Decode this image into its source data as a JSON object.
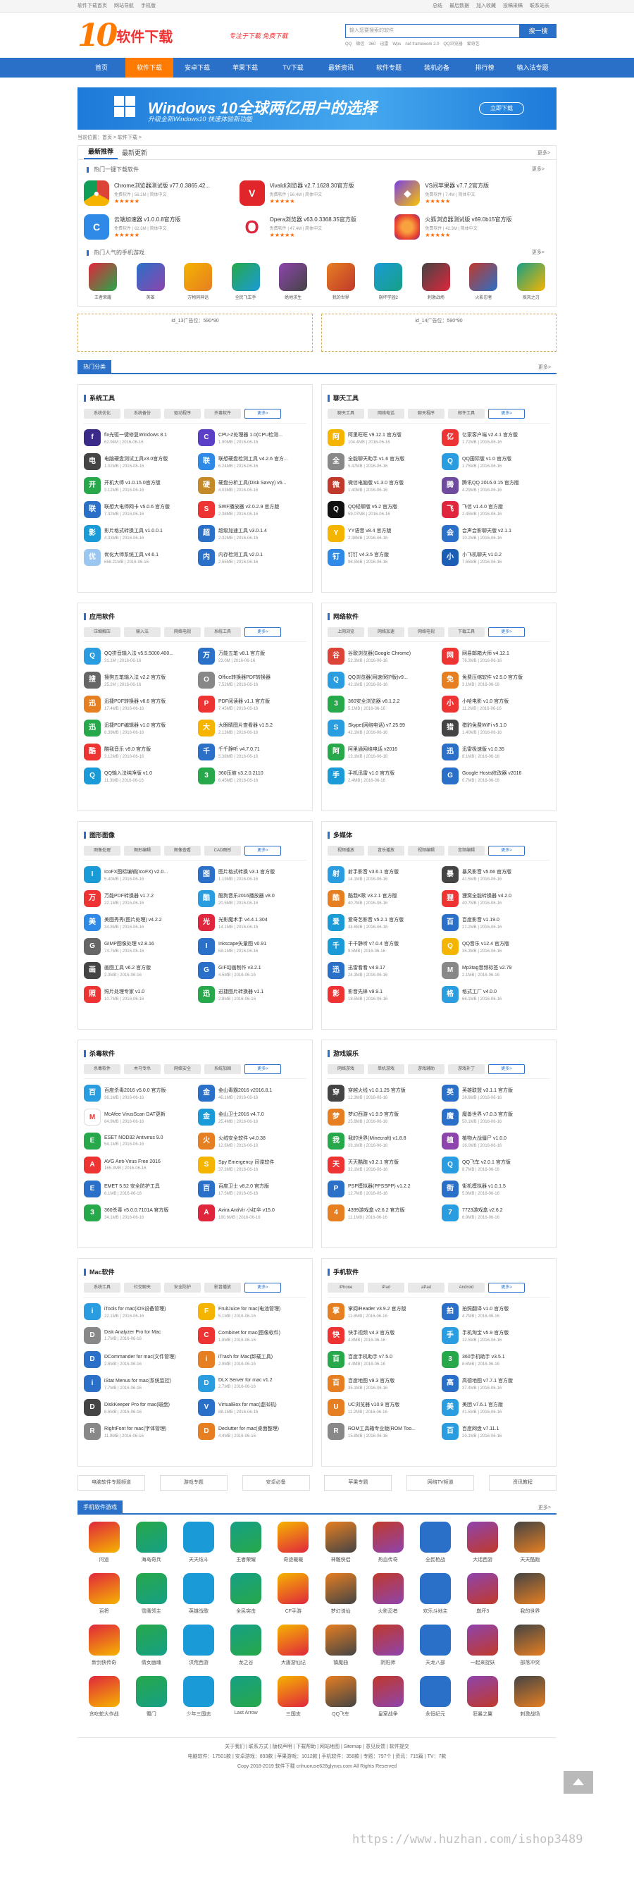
{
  "topbar": {
    "left": [
      "软件下载首页",
      "网站导航",
      "手机版"
    ],
    "right": [
      "总结",
      "最后数据",
      "加入收藏",
      "投稿采稿",
      "联系站长"
    ]
  },
  "logo": {
    "mark": "10",
    "text": "软件下载"
  },
  "slogan": "专注于下载 免费下载",
  "search": {
    "placeholder": "输入您要搜索的软件",
    "button": "搜一搜",
    "hot": [
      "QQ",
      "微信",
      "360",
      "迅雷",
      "Wps",
      "net framework 2.0",
      "QQ浏览器",
      "爱奇艺"
    ]
  },
  "nav": [
    "首页",
    "软件下载",
    "安卓下载",
    "苹果下载",
    "TV下载",
    "最新资讯",
    "软件专题",
    "装机必备",
    "排行榜",
    "输入法专题"
  ],
  "banner": {
    "title": "Windows 10全球两亿用户的选择",
    "sub": "升级全新Windows10 快速体验新功能",
    "btn": "立即下载"
  },
  "crumb": "当前位置：首页 > 软件下载 >",
  "rec": {
    "tabs": [
      "最新推荐",
      "最新更新"
    ],
    "more": "更多>",
    "sub": "热门一键下载软件",
    "items": [
      {
        "name": "Chrome浏览器测试版 v77.0.3865.42...",
        "meta": "免费软件 | 56.2M | 简体中文",
        "color": "#ffffff",
        "ch": "●",
        "ico": "chrome-icon",
        "bg": "conic-gradient(#db4437 0 33%,#f4b400 0 66%,#0f9d58 0)"
      },
      {
        "name": "Vivaldi浏览器 v2.7.1628.30官方版",
        "meta": "免费软件 | 56.4M | 简体中文",
        "ico": "vivaldi-icon",
        "bg": "#e0262b",
        "ch": "V"
      },
      {
        "name": "VS间苹果器 v7.7.2官方版",
        "meta": "免费软件 | 7.4M | 简体中文",
        "ico": "vs-icon",
        "bg": "linear-gradient(135deg,#7b3fe4,#f9c600)",
        "ch": "◆"
      },
      {
        "name": "云端加速器 v1.0.0.8官方版",
        "meta": "免费软件 | 62.3M | 简体中文",
        "ico": "cloud-icon",
        "bg": "#2e8ae6",
        "ch": "C"
      },
      {
        "name": "Opera浏览器 v63.0.3368.35官方版",
        "meta": "免费软件 | 47.4M | 简体中文",
        "ico": "opera-icon",
        "bg": "#ffffff",
        "ch": "O"
      },
      {
        "name": "火狐浏览器测试版 v69.0b15官方版",
        "meta": "免费软件 | 42.3M | 简体中文",
        "ico": "firefox-icon",
        "bg": "radial-gradient(circle,#f9a03f 30%,#e63d2f 70%,#6e3ab3)",
        "ch": ""
      }
    ],
    "rating": "★★★★★",
    "mobile_sub": "热门人气的手机游戏",
    "mobile": [
      "王者荣耀",
      "英雄",
      "万物同神话",
      "全民飞车手",
      "绝地求生",
      "我的世界",
      "崩坏学园2",
      "刺激战场",
      "火影忍者",
      "疾风之刃"
    ]
  },
  "ads": [
    "id_13广告位：590*90",
    "id_14广告位：590*90"
  ],
  "cat_title": "热门分类",
  "more": "更多>",
  "cats": [
    {
      "title": "系统工具",
      "tags": [
        "系统优化",
        "系统备份",
        "驱动程序",
        "杀毒软件",
        "更多>"
      ],
      "items": [
        {
          "n": "fix光驱一键修复Windows 8.1",
          "m": "62.94M | 2016-06-16",
          "c": "#3b2a88"
        },
        {
          "n": "CPU-Z处理器 1.0(CPU检测...",
          "m": "1.90MB | 2016-06-16",
          "c": "#5b3fc7"
        },
        {
          "n": "电脑硬盘测试工具v3.0官方版",
          "m": "1.02MB | 2016-06-16",
          "c": "#444"
        },
        {
          "n": "联想硬盘检测工具 v4.2.6 官方...",
          "m": "6.24MB | 2016-06-16",
          "c": "#2e8ae6"
        },
        {
          "n": "开机大师 v1.0.15.0官方版",
          "m": "3.12MB | 2016-06-16",
          "c": "#27a84a"
        },
        {
          "n": "硬盘分析工具(Disk Savvy) v6...",
          "m": "4.03MB | 2016-06-16",
          "c": "#c48a2a"
        },
        {
          "n": "联想大电师网卡 v5.0.6 官方版",
          "m": "7.32MB | 2016-06-16",
          "c": "#2a70c8"
        },
        {
          "n": "SWF播放器 v2.0.2.9 官方版",
          "m": "2.38MB | 2016-06-16",
          "c": "#e33"
        },
        {
          "n": "影片格式转换工具 v1.0.0.1",
          "m": "4.33MB | 2016-06-16",
          "c": "#1a9bd7"
        },
        {
          "n": "超级加速工具 v3.0.1.4",
          "m": "2.32MB | 2016-06-16",
          "c": "#2a70c8"
        },
        {
          "n": "优化大师系统工具 v4.6.1",
          "m": "668.21MB | 2016-06-16",
          "c": "#9ac6f0"
        },
        {
          "n": "内存检测工具 v2.0.1",
          "m": "2.55MB | 2016-06-16",
          "c": "#2a70c8"
        }
      ]
    },
    {
      "title": "聊天工具",
      "tags": [
        "聊天工具",
        "网络电话",
        "聊天程序",
        "邮件工具",
        "更多>"
      ],
      "items": [
        {
          "n": "阿里旺旺 v9.12.1 官方版",
          "m": "104.4MB | 2016-06-16",
          "c": "#f5b400"
        },
        {
          "n": "亿家客户端 v2.4.1 官方版",
          "m": "1.72MB | 2016-06-16",
          "c": "#e33"
        },
        {
          "n": "全能聊天助手 v1.6 官方版",
          "m": "5.47MB | 2016-06-16",
          "c": "#888"
        },
        {
          "n": "QQ国际版 v1.0 官方版",
          "m": "1.75MB | 2016-06-16",
          "c": "#2a9de0"
        },
        {
          "n": "微信电脑版 v1.3.0 官方版",
          "m": "1.40MB | 2016-06-16",
          "c": "#c0392b"
        },
        {
          "n": "腾讯QQ 2016.0.15 官方版",
          "m": "4.29MB | 2016-06-16",
          "c": "#6e4b9e"
        },
        {
          "n": "QQ轻聊版 v5.2 官方版",
          "m": "59.07MB | 2016-06-16",
          "c": "#111"
        },
        {
          "n": "飞信 v1.4.0 官方版",
          "m": "2.45MB | 2016-06-16",
          "c": "#e0263c"
        },
        {
          "n": "YY语音 v8.4 官方版",
          "m": "2.38MB | 2016-06-16",
          "c": "#f5b400"
        },
        {
          "n": "会声会影聊天版 v2.1.1",
          "m": "10.2MB | 2016-06-16",
          "c": "#2a70c8"
        },
        {
          "n": "钉钉 v4.3.5 官方版",
          "m": "96.5MB | 2016-06-16",
          "c": "#2e8ae6"
        },
        {
          "n": "小飞机聊天 v1.0.2",
          "m": "7.65MB | 2016-06-16",
          "c": "#1a5fb4"
        }
      ]
    },
    {
      "title": "应用软件",
      "tags": [
        "压缩解压",
        "输入法",
        "网络电视",
        "系统工具",
        "更多>"
      ],
      "items": [
        {
          "n": "QQ拼音输入法 v5.5.5000.400...",
          "m": "31.1M | 2016-06-16",
          "c": "#2a9de0"
        },
        {
          "n": "万能五笔 v8.1 官方版",
          "m": "23.0M | 2016-06-16",
          "c": "#2a70c8"
        },
        {
          "n": "搜狗五笔输入法 v2.2 官方版",
          "m": "25.2M | 2016-06-16",
          "c": "#666"
        },
        {
          "n": "Office转换器PDF转换器",
          "m": "7.52MB | 2016-06-16",
          "c": "#888"
        },
        {
          "n": "迅捷PDF转换器 v6.6 官方版",
          "m": "17.4MB | 2016-06-16",
          "c": "#e67e22"
        },
        {
          "n": "PDF阅读器 v1.1 官方版",
          "m": "7.45MB | 2016-06-16",
          "c": "#e33"
        },
        {
          "n": "迅捷PDF编辑器 v1.0 官方版",
          "m": "8.39MB | 2016-06-16",
          "c": "#27a84a"
        },
        {
          "n": "大眼睛图片查看器 v1.5.2",
          "m": "2.13MB | 2016-06-16",
          "c": "#f5b400"
        },
        {
          "n": "酷我音乐 v9.0 官方版",
          "m": "3.12MB | 2016-06-16",
          "c": "#e33"
        },
        {
          "n": "千千静听 v4.7.0.71",
          "m": "5.38MB | 2016-06-16",
          "c": "#2a70c8"
        },
        {
          "n": "QQ输入法纯净版 v1.0",
          "m": "11.3MB | 2016-06-16",
          "c": "#1a9bd7"
        },
        {
          "n": "360压缩 v3.2.0.2110",
          "m": "6.45MB | 2016-06-16",
          "c": "#27a84a"
        }
      ]
    },
    {
      "title": "网络软件",
      "tags": [
        "上网浏览",
        "网络加速",
        "网络电视",
        "下载工具",
        "更多>"
      ],
      "items": [
        {
          "n": "谷歌浏览器(Google Chrome)",
          "m": "52.1MB | 2016-06-16",
          "c": "#db4437"
        },
        {
          "n": "网易邮箱大师 v4.12.1",
          "m": "76.3MB | 2016-06-16",
          "c": "#e33"
        },
        {
          "n": "QQ浏览器(网速保护版)v9...",
          "m": "42.1MB | 2016-06-16",
          "c": "#2a9de0"
        },
        {
          "n": "免费压缩软件 v2.5.0 官方版",
          "m": "3.1MB | 2016-06-16",
          "c": "#e67e22"
        },
        {
          "n": "360安全浏览器 v8.1.2.2",
          "m": "5.1MB | 2016-06-16",
          "c": "#27a84a"
        },
        {
          "n": "小哈电影 v1.0 官方版",
          "m": "11.2MB | 2016-06-16",
          "c": "#e33"
        },
        {
          "n": "Skype(网络电话) v7.25.99",
          "m": "42.1MB | 2016-06-16",
          "c": "#2a9de0"
        },
        {
          "n": "猎豹免费WiFi v5.1.0",
          "m": "1.40MB | 2016-06-16",
          "c": "#444"
        },
        {
          "n": "阿里通网络电话 v2016",
          "m": "13.1MB | 2016-06-16",
          "c": "#27a84a"
        },
        {
          "n": "迅雷极速版 v1.0.35",
          "m": "8.1MB | 2016-06-16",
          "c": "#2a70c8"
        },
        {
          "n": "手机迅雷 v1.0 官方版",
          "m": "2.4MB | 2016-06-16",
          "c": "#1a9bd7"
        },
        {
          "n": "Google Hosts修改器 v2016",
          "m": "0.7MB | 2016-06-16",
          "c": "#2a70c8"
        }
      ]
    },
    {
      "title": "图形图像",
      "tags": [
        "图像处理",
        "图形编辑",
        "图像查看",
        "CAD图形",
        "更多>"
      ],
      "items": [
        {
          "n": "IcoFX图标编辑(IcoFX) v2.0...",
          "m": "5.40MB | 2016-06-16",
          "c": "#1a9bd7"
        },
        {
          "n": "图片格式转换 v3.1 官方版",
          "m": "1.19MB | 2016-06-16",
          "c": "#2a70c8"
        },
        {
          "n": "万能PDF转换器 v1.7.2",
          "m": "22.1MB | 2016-06-16",
          "c": "#e33"
        },
        {
          "n": "酷狗音乐2016播放器 v8.0",
          "m": "20.5MB | 2016-06-16",
          "c": "#2a9de0"
        },
        {
          "n": "美图秀秀(图片处理) v4.2.2",
          "m": "34.8MB | 2016-06-16",
          "c": "#2e8ae6"
        },
        {
          "n": "光影魔术手 v4.4.1.304",
          "m": "14.1MB | 2016-06-16",
          "c": "#e0263c"
        },
        {
          "n": "GIMP图像处理 v2.8.16",
          "m": "74.7MB | 2016-06-16",
          "c": "#666"
        },
        {
          "n": "Inkscape矢量图 v0.91",
          "m": "58.1MB | 2016-06-16",
          "c": "#2a70c8"
        },
        {
          "n": "画图工具 v6.2 官方版",
          "m": "2.3MB | 2016-06-16",
          "c": "#444"
        },
        {
          "n": "GIF动画制作 v3.2.1",
          "m": "4.5MB | 2016-06-16",
          "c": "#2a70c8"
        },
        {
          "n": "照片处理专家 v1.0",
          "m": "10.7MB | 2016-06-16",
          "c": "#e33"
        },
        {
          "n": "迅捷图片转换器 v1.1",
          "m": "2.8MB | 2016-06-16",
          "c": "#27a84a"
        }
      ]
    },
    {
      "title": "多媒体",
      "tags": [
        "视频播放",
        "音乐播放",
        "视频编辑",
        "音频编辑",
        "更多>"
      ],
      "items": [
        {
          "n": "射手影音 v3.6.1 官方版",
          "m": "14.1MB | 2016-06-16",
          "c": "#2a9de0"
        },
        {
          "n": "暴风影音 v5.66 官方版",
          "m": "41.5MB | 2016-06-16",
          "c": "#444"
        },
        {
          "n": "酷我K歌 v3.2.1 官方版",
          "m": "40.7MB | 2016-06-16",
          "c": "#e67e22"
        },
        {
          "n": "狸窝全能转换器 v4.2.0",
          "m": "40.7MB | 2016-06-16",
          "c": "#e33"
        },
        {
          "n": "爱奇艺影音 v5.2.1 官方版",
          "m": "34.6MB | 2016-06-16",
          "c": "#1a9bd7"
        },
        {
          "n": "百度影音 v1.19.0",
          "m": "21.2MB | 2016-06-16",
          "c": "#2a70c8"
        },
        {
          "n": "千千静听 v7.0.4 官方版",
          "m": "9.5MB | 2016-06-16",
          "c": "#1a9bd7"
        },
        {
          "n": "QQ音乐 v12.4 官方版",
          "m": "35.3MB | 2016-06-16",
          "c": "#f5b400"
        },
        {
          "n": "迅雷看看 v4.9.17",
          "m": "24.3MB | 2016-06-16",
          "c": "#2a70c8"
        },
        {
          "n": "Mp3tag音频标签 v2.79",
          "m": "2.1MB | 2016-06-16",
          "c": "#888"
        },
        {
          "n": "影音先锋 v9.9.1",
          "m": "18.5MB | 2016-06-16",
          "c": "#e33"
        },
        {
          "n": "格式工厂 v4.0.0",
          "m": "66.1MB | 2016-06-16",
          "c": "#2a9de0"
        }
      ]
    },
    {
      "title": "杀毒软件",
      "tags": [
        "杀毒软件",
        "木马专杀",
        "网络安全",
        "系统加固",
        "更多>"
      ],
      "items": [
        {
          "n": "百度杀毒2016 v5.0.0 官方版",
          "m": "36.1MB | 2016-06-16",
          "c": "#2a9de0"
        },
        {
          "n": "金山毒霸2016 v2016.8.1",
          "m": "46.1MB | 2016-06-16",
          "c": "#2a70c8"
        },
        {
          "n": "McAfee VirusScan DAT更新",
          "m": "84.9MB | 2016-06-16",
          "c": "#fff"
        },
        {
          "n": "金山卫士2016 v4.7.0",
          "m": "25.4MB | 2016-06-16",
          "c": "#1a9bd7"
        },
        {
          "n": "ESET NOD32 Antivirus 9.0",
          "m": "54.1MB | 2016-06-16",
          "c": "#27a84a"
        },
        {
          "n": "火绒安全软件 v4.0.38",
          "m": "12.6MB | 2016-06-16",
          "c": "#e67e22"
        },
        {
          "n": "AVG Anti-Virus Free 2016",
          "m": "165.3MB | 2016-06-16",
          "c": "#e33"
        },
        {
          "n": "Spy Emergency 间谍软件",
          "m": "37.3MB | 2016-06-16",
          "c": "#f5b400"
        },
        {
          "n": "EMET 5.52 安全防护工具",
          "m": "8.1MB | 2016-06-16",
          "c": "#2a70c8"
        },
        {
          "n": "百度卫士 v8.2.0 官方版",
          "m": "17.5MB | 2016-06-16",
          "c": "#2a70c8"
        },
        {
          "n": "360杀毒 v5.0.0.7101A 官方版",
          "m": "34.1MB | 2016-06-16",
          "c": "#27a84a"
        },
        {
          "n": "Avira AntiVir 小红伞 v15.0",
          "m": "180.6MB | 2016-06-16",
          "c": "#e0263c"
        }
      ]
    },
    {
      "title": "游戏娱乐",
      "tags": [
        "网络游戏",
        "单机游戏",
        "游戏辅助",
        "游戏补丁",
        "更多>"
      ],
      "items": [
        {
          "n": "穿越火线 v1.0.1.25 官方版",
          "m": "12.3MB | 2016-06-16",
          "c": "#444"
        },
        {
          "n": "英雄联盟 v3.1.1 官方版",
          "m": "26.6MB | 2016-06-16",
          "c": "#2a70c8"
        },
        {
          "n": "梦幻西游 v1.9.9 官方版",
          "m": "25.6MB | 2016-06-16",
          "c": "#e67e22"
        },
        {
          "n": "魔兽世界 v7.0.3 官方版",
          "m": "50.1MB | 2016-06-16",
          "c": "#2a70c8"
        },
        {
          "n": "我的世界(Minecraft) v1.8.8",
          "m": "28.1MB | 2016-06-16",
          "c": "#27a84a"
        },
        {
          "n": "植物大战僵尸 v1.0.0",
          "m": "16.0MB | 2016-06-16",
          "c": "#8e44ad"
        },
        {
          "n": "天天酷跑 v3.2.1 官方版",
          "m": "32.1MB | 2016-06-16",
          "c": "#e33"
        },
        {
          "n": "QQ飞车 v2.0.1 官方版",
          "m": "8.7MB | 2016-06-16",
          "c": "#2a9de0"
        },
        {
          "n": "PSP模拟器(PPSSPP) v1.2.2",
          "m": "12.7MB | 2016-06-16",
          "c": "#2a70c8"
        },
        {
          "n": "街机模拟器 v1.0.1.5",
          "m": "5.8MB | 2016-06-16",
          "c": "#2a70c8"
        },
        {
          "n": "4399游戏盒 v2.6.2 官方版",
          "m": "11.1MB | 2016-06-16",
          "c": "#e67e22"
        },
        {
          "n": "7723游戏盒 v2.6.2",
          "m": "6.9MB | 2016-06-16",
          "c": "#2a9de0"
        }
      ]
    },
    {
      "title": "Mac软件",
      "tags": [
        "系统工具",
        "社交聊天",
        "安全防护",
        "影音播放",
        "更多>"
      ],
      "items": [
        {
          "n": "iTools for mac(iOS设备管理)",
          "m": "22.1MB | 2016-06-16",
          "c": "#2a9de0"
        },
        {
          "n": "FruitJuice for mac(电池管理)",
          "m": "5.1MB | 2016-06-16",
          "c": "#f5b400"
        },
        {
          "n": "Disk Analyzer Pro for Mac",
          "m": "1.7MB | 2016-06-16",
          "c": "#888"
        },
        {
          "n": "Combinet for mac(图像软件)",
          "m": "1.8MB | 2016-06-16",
          "c": "#e33"
        },
        {
          "n": "DCommander for mac(文件管理)",
          "m": "2.6MB | 2016-06-16",
          "c": "#2a70c8"
        },
        {
          "n": "iTrash for Mac(卸载工具)",
          "m": "2.9MB | 2016-06-16",
          "c": "#e67e22"
        },
        {
          "n": "iStat Menus for mac(系统监控)",
          "m": "7.7MB | 2016-06-16",
          "c": "#2a70c8"
        },
        {
          "n": "DLX Server for mac v1.2",
          "m": "2.7MB | 2016-06-16",
          "c": "#2a9de0"
        },
        {
          "n": "DiskKeeper Pro for mac(磁盘)",
          "m": "8.6MB | 2016-06-16",
          "c": "#444"
        },
        {
          "n": "VirtualBox for mac(虚拟机)",
          "m": "88.1MB | 2016-06-16",
          "c": "#2a70c8"
        },
        {
          "n": "RightFont for mac(字体管理)",
          "m": "11.9MB | 2016-06-16",
          "c": "#888"
        },
        {
          "n": "Declutter for mac(桌面整理)",
          "m": "4.4MB | 2016-06-16",
          "c": "#e67e22"
        }
      ]
    },
    {
      "title": "手机软件",
      "tags": [
        "iPhone",
        "iPad",
        "aPad",
        "Android",
        "更多>"
      ],
      "items": [
        {
          "n": "掌阅iReader v3.9.2 官方版",
          "m": "11.8MB | 2016-06-16",
          "c": "#e67e22"
        },
        {
          "n": "拍照翻译 v1.0 官方版",
          "m": "4.7MB | 2016-06-16",
          "c": "#2a70c8"
        },
        {
          "n": "快手视频 v4.3 官方版",
          "m": "4.8MB | 2016-06-16",
          "c": "#e33"
        },
        {
          "n": "手机淘宝 v5.9 官方版",
          "m": "12.5MB | 2016-06-16",
          "c": "#2a9de0"
        },
        {
          "n": "百度手机助手 v7.5.0",
          "m": "4.4MB | 2016-06-16",
          "c": "#27a84a"
        },
        {
          "n": "360手机助手 v3.5.1",
          "m": "8.6MB | 2016-06-16",
          "c": "#27a84a"
        },
        {
          "n": "百度地图 v9.3 官方版",
          "m": "35.1MB | 2016-06-16",
          "c": "#e67e22"
        },
        {
          "n": "高德地图 v7.7.1 官方版",
          "m": "37.4MB | 2016-06-16",
          "c": "#2a70c8"
        },
        {
          "n": "UC浏览器 v10.9 官方版",
          "m": "11.2MB | 2016-06-16",
          "c": "#e67e22"
        },
        {
          "n": "美团 v7.6.1 官方版",
          "m": "41.5MB | 2016-06-16",
          "c": "#2a9de0"
        },
        {
          "n": "ROM工具箱专业版(ROM Too...",
          "m": "15.8MB | 2016-06-16",
          "c": "#888"
        },
        {
          "n": "百度网盘 v7.11.1",
          "m": "20.1MB | 2016-06-16",
          "c": "#2a9de0"
        }
      ]
    }
  ],
  "bottom_links": [
    "电脑软件专题频道",
    "游戏专题",
    "安卓必备",
    "苹果专题",
    "网络TV频道",
    "资讯教程"
  ],
  "mobile_title": "手机软件游戏",
  "mobile_grid": [
    "问道",
    "海岛奇兵",
    "天天炫斗",
    "王者荣耀",
    "奇迹暖暖",
    "神雕侠侣",
    "热血传奇",
    "全民枪战",
    "大话西游",
    "天天酷跑",
    "百将",
    "雪鹰领主",
    "英雄战歌",
    "全民突击",
    "CF手游",
    "梦幻诛仙",
    "火影忍者",
    "欢乐斗地主",
    "崩坏3",
    "我的世界",
    "新剑侠传奇",
    "倩女幽魂",
    "洪荒西游",
    "龙之谷",
    "大唐游仙记",
    "镇魔曲",
    "阴阳师",
    "天龙八部",
    "一起来捉妖",
    "部落冲突",
    "贪吃蛇大作战",
    "蜀门",
    "少年三国志",
    "Last Arrow",
    "三国志",
    "QQ飞车",
    "皇室战争",
    "永恒纪元",
    "狂暴之翼",
    "刺激战场"
  ],
  "footer": {
    "links": "关于我们 | 联系方式 | 版权声明 | 下载帮助 | 网站地图 | Sitemap | 意见反馈 | 软件提交",
    "stat": "电脑软件：17501款 | 安卓游戏：893款 | 苹果游戏：1012款 | 手机软件：358款 | 专题：797个 | 资讯：715篇 | TV：7款",
    "copy": "Copy 2018-2019 软件下载 cnhuoruse628glynxs.com All Rights Reserved"
  },
  "watermark": "https://www.huzhan.com/ishop3489"
}
